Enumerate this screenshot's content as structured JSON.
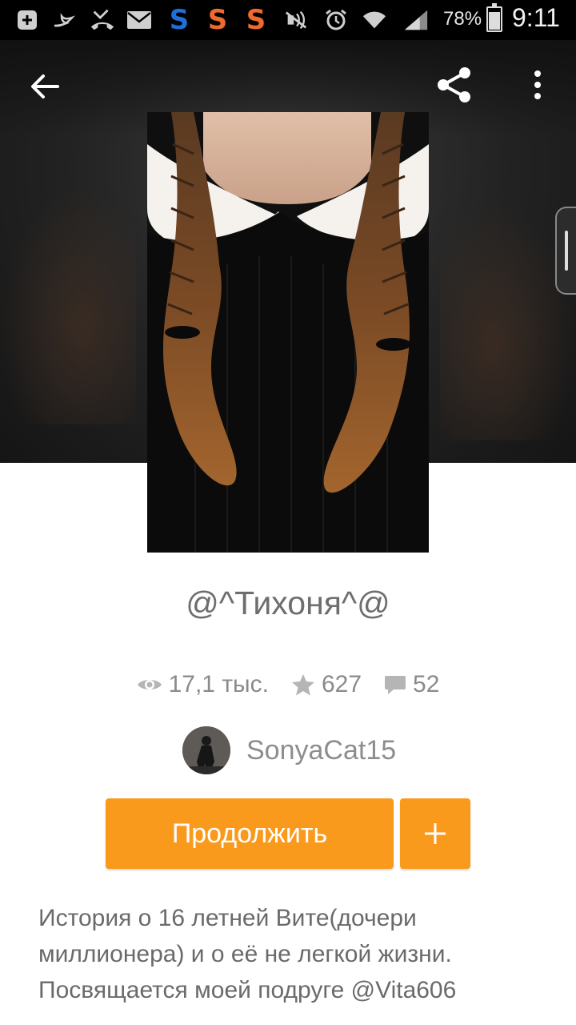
{
  "status_bar": {
    "battery_percent": "78%",
    "battery_level": 0.78,
    "time": "9:11"
  },
  "header": {
    "icons": [
      "back-arrow-icon",
      "share-icon",
      "more-vert-icon"
    ]
  },
  "story": {
    "title": "@^Тихоня^@",
    "views": "17,1 тыс.",
    "votes": "627",
    "comments": "52",
    "author": "SonyaCat15",
    "continue_label": "Продолжить",
    "add_label": "+",
    "description": "История о 16 летней Вите(дочери миллионера) и о её не легкой жизни. Посвящается моей подруге @Vita606"
  },
  "colors": {
    "accent": "#f99a1d",
    "header_bg": "#222222",
    "text_muted": "#8a8a8a"
  }
}
